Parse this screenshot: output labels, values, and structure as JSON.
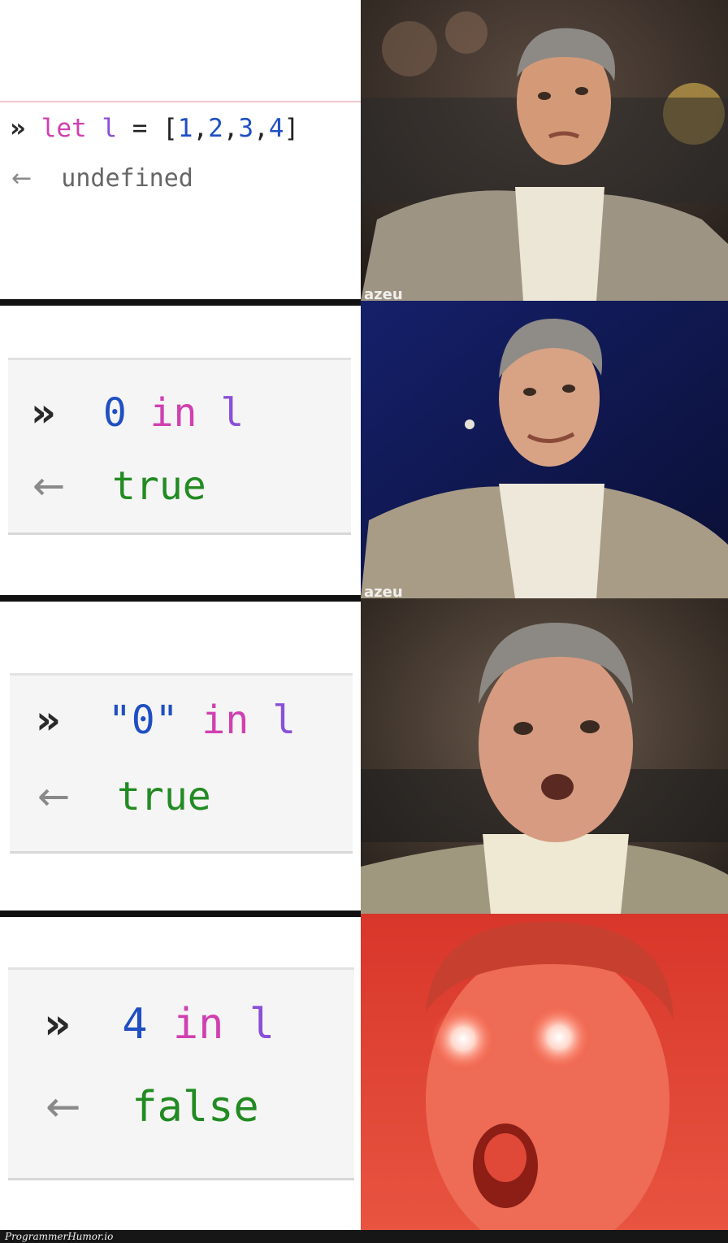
{
  "panels": [
    {
      "prompt_glyph": "»",
      "input_tokens": [
        "let",
        "l",
        "=",
        "[",
        "1",
        ",",
        "2",
        ",",
        "3",
        ",",
        "4",
        "]"
      ],
      "result_glyph": "←",
      "result": "undefined",
      "photo_watermark": "azeu"
    },
    {
      "prompt_glyph": "»",
      "input_tokens": [
        "0",
        "in",
        "l"
      ],
      "result_glyph": "←",
      "result": "true",
      "photo_watermark": "azeu"
    },
    {
      "prompt_glyph": "»",
      "input_tokens": [
        "\"0\"",
        "in",
        "l"
      ],
      "result_glyph": "←",
      "result": "true"
    },
    {
      "prompt_glyph": "»",
      "input_tokens": [
        "4",
        "in",
        "l"
      ],
      "result_glyph": "←",
      "result": "false"
    }
  ],
  "colors": {
    "keyword": "#d040b0",
    "identifier": "#8a4fd8",
    "number": "#1f4fc2",
    "boolean": "#228b22",
    "undefined": "#666666",
    "red_glow": "#e8402a"
  },
  "footer": {
    "watermark": "ProgrammerHumor.io"
  }
}
